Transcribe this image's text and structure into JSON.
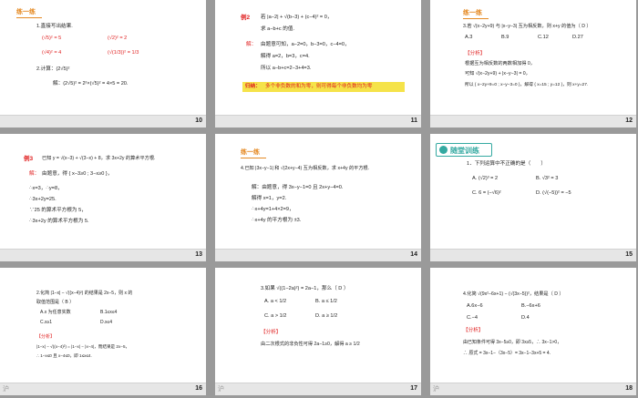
{
  "slides": [
    {
      "num": "10",
      "lic": "",
      "lines": [
        "练一练",
        "1.直接写出结果.",
        "(√5)² = 5",
        "(√2)² = 2",
        "(√4)² = 4",
        "(√(1/3))² = 1/3",
        "2.计算：(2√5)²",
        "解：(2√5)² = 2²×(√5)² = 4×5 = 20."
      ]
    },
    {
      "num": "11",
      "lic": "",
      "lines": [
        "例2",
        "若 |a−2| + √(b−3) + (c−4)² = 0，",
        "求 a−b+c 的值.",
        "解：",
        "由题意可知，a−2=0，b−3=0，c−4=0，",
        "解得 a=2，b=3，c=4.",
        "所以 a−b+c=2−3+4=3.",
        "归纳：",
        "多个非负数的和为零，则可得每个非负数均为零"
      ]
    },
    {
      "num": "12",
      "lic": "",
      "lines": [
        "练一练",
        "3.若 √(x−2y+9) 与 |x−y−3| 互为相反数，则 x+y 的值为（ D ）",
        "A.3",
        "B.9",
        "C.12",
        "D.27",
        "【分析】",
        "根据互为相反数的两数相加得 0，",
        "可知 √(x−2y+9) + |x−y−3| = 0，",
        "所以 { x−2y+9=0 ; x−y−3=0 }，解得 { x=15 ; y=12 }，则 x+y=27."
      ]
    },
    {
      "num": "13",
      "lic": "",
      "lines": [
        "例3",
        "已知 y = √(x−3) + √(3−x) + 8，求 3x+2y 的算术平方根.",
        "解：",
        "由题意，得 { x−3≥0 ; 3−x≥0 }，",
        "∴x=3，∴y=8，",
        "∴3x+2y=25.",
        "∵25 的算术平方根为 5，",
        "∴3x+2y 的算术平方根为 5."
      ]
    },
    {
      "num": "14",
      "lic": "",
      "lines": [
        "练一练",
        "4.已知 |3x−y−1| 和 √(2x+y−4) 互为相反数，求 x+4y 的平方根.",
        "解：由题意，得 3x−y−1=0 且 2x+y−4=0.",
        "解得 x=1，y=2.",
        "∴x+4y=1+4×2=9，",
        "∴x+4y 的平方根为 ±3."
      ]
    },
    {
      "num": "15",
      "lic": "",
      "lines": [
        "随堂训练",
        "1．下列运算中不正确的是（　　）",
        "A. (√2)³ = 2",
        "B. √3² = 3",
        "C. 6 = (−√6)²",
        "D. (√(−5))² = −5"
      ]
    },
    {
      "num": "16",
      "lic": "沪",
      "lines": [
        "2.化简 |1−x| − √((x−4)²) 的结果是 2x−5，则 x 的",
        "取值范围是（ B ）",
        "A.x 为任意实数",
        "B.1≤x≤4",
        "C.x≥1",
        "D.x≤4",
        "【分析】",
        "|1−x| − √((x−4)²) = |1−x| − |x−4|，而结果是 2x−5，",
        "∴ 1−x≤0 且 x−4≤0，即 1≤x≤4."
      ]
    },
    {
      "num": "17",
      "lic": "沪",
      "lines": [
        "3.如果 √((1−2a)²) = 2a−1，那么（ D ）",
        "A. a < 1/2",
        "B. a ≤ 1/2",
        "C. a > 1/2",
        "D. a ≥ 1/2",
        "【分析】",
        "由二次根式的非负性可得 2a−1≥0，解得 a ≥ 1/2"
      ]
    },
    {
      "num": "18",
      "lic": "沪",
      "lines": [
        "4.化简 √(9x²−6x+1) − (√(3x−5))²，结果是（ D ）",
        "A.6x−6",
        "B.−6x+6",
        "C.−4",
        "D.4",
        "【分析】",
        "由已知条件可得 3x−5≥0，即 3x≥5，∴ 3x−1>0，",
        "∴ 原式 = 3x−1−（3x−5）= 3x−1−3x+5 = 4."
      ]
    }
  ]
}
